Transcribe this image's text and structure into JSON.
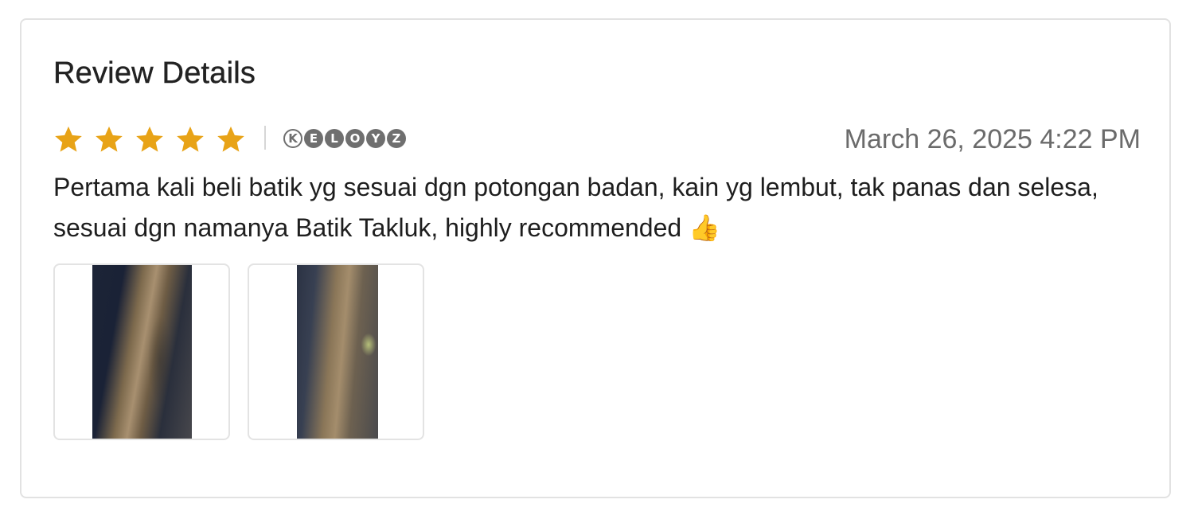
{
  "review": {
    "heading": "Review Details",
    "rating": 5,
    "rating_max": 5,
    "star_color": "#E8A317",
    "username_chars": [
      "K",
      "E",
      "L",
      "O",
      "Y",
      "Z"
    ],
    "timestamp": "March 26, 2025 4:22 PM",
    "text": "Pertama kali beli batik yg sesuai dgn potongan badan, kain yg lembut, tak panas dan selesa, sesuai dgn namanya Batik Takluk, highly recommended 👍",
    "photos": [
      {
        "icon": "review-photo"
      },
      {
        "icon": "review-photo"
      }
    ]
  }
}
